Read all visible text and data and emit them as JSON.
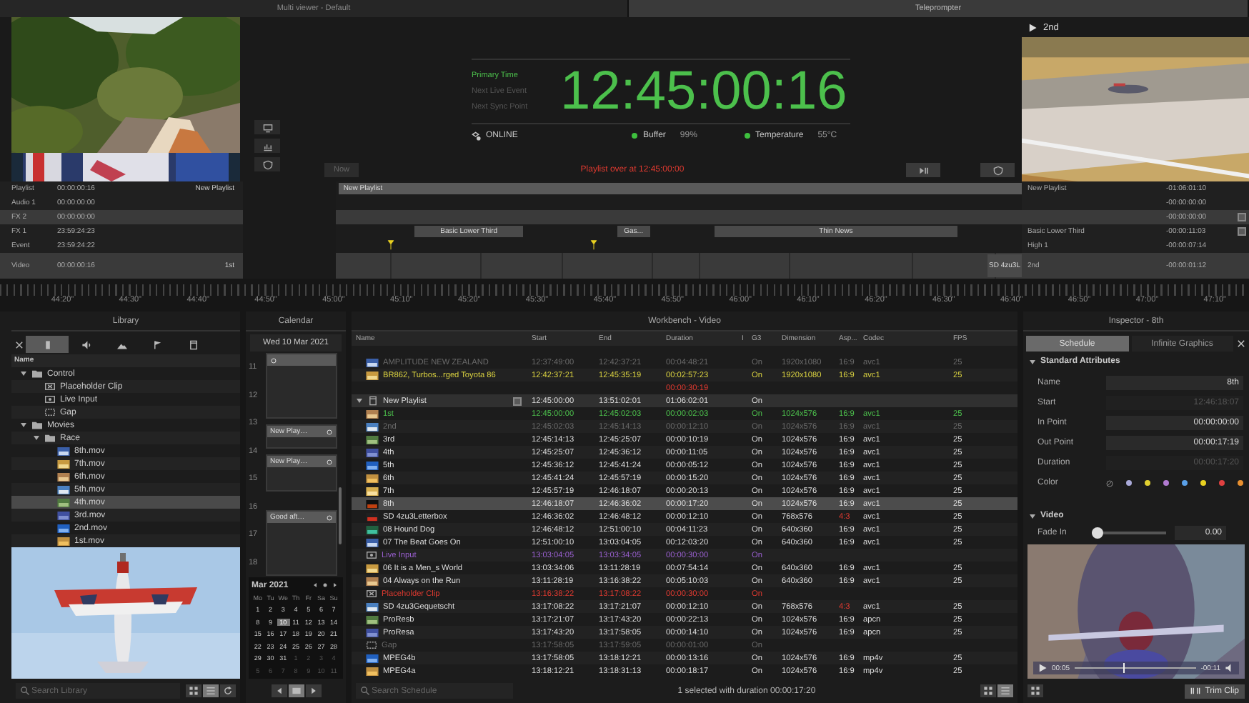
{
  "multiviewer": {
    "title": "Multi viewer - Default"
  },
  "teleprompter": {
    "title": "Teleprompter"
  },
  "clock": {
    "labels": [
      {
        "text": "Primary Time",
        "selected": true
      },
      {
        "text": "Next Live Event",
        "selected": false
      },
      {
        "text": "Next Sync Point",
        "selected": false
      }
    ],
    "time": "12:45:00:16",
    "connection": "ONLINE",
    "meters": [
      {
        "label": "Buffer",
        "value": "99%",
        "ok": true
      },
      {
        "label": "Temperature",
        "value": "55°C",
        "ok": true
      }
    ],
    "message": "Playlist over at 12:45:00:00",
    "now_button": {
      "label": "Now",
      "disabled": true
    }
  },
  "preview": {
    "title": "2nd"
  },
  "tracks": [
    {
      "name": "Playlist",
      "time": "00:00:00:16",
      "clip": "New Playlist",
      "shaded": false,
      "items": [
        {
          "kind": "bar",
          "label": "New Playlist"
        }
      ]
    },
    {
      "name": "Audio 1",
      "time": "00:00:00:00",
      "shaded": false
    },
    {
      "name": "FX 2",
      "time": "00:00:00:00",
      "shaded": true
    },
    {
      "name": "FX 1",
      "time": "23:59:24:23",
      "shaded": false,
      "items": [
        {
          "kind": "clip",
          "label": "Basic Lower Third"
        },
        {
          "kind": "clip",
          "label": "Gas..."
        },
        {
          "kind": "clip",
          "label": "Thin News"
        }
      ]
    },
    {
      "name": "Event",
      "time": "23:59:24:22",
      "shaded": false,
      "items": [
        {
          "kind": "marker"
        },
        {
          "kind": "marker"
        }
      ]
    },
    {
      "name": "Video",
      "time": "00:00:00:16",
      "clip": "1st",
      "shaded": true,
      "items": [
        {
          "kind": "clip",
          "label": "SD 4zu3L"
        }
      ]
    }
  ],
  "remaining": [
    {
      "name": "New Playlist",
      "time": "-01:06:01:10",
      "button": false
    },
    {
      "time": "-00:00:00:00",
      "button": false
    },
    {
      "time": "-00:00:00:00",
      "button": true
    },
    {
      "name": "Basic Lower Third",
      "time": "-00:00:11:03",
      "button": true
    },
    {
      "name": "High 1",
      "time": "-00:00:07:14",
      "button": false
    },
    {
      "name": "2nd",
      "time": "-00:00:01:12",
      "button": false
    }
  ],
  "ruler": [
    "44:20\"",
    "44:30\"",
    "44:40\"",
    "44:50\"",
    "45:00\"",
    "45:10\"",
    "45:20\"",
    "45:30\"",
    "45:40\"",
    "45:50\"",
    "46:00\"",
    "46:10\"",
    "46:20\"",
    "46:30\"",
    "46:40\"",
    "46:50\"",
    "47:00\"",
    "47:10\""
  ],
  "library": {
    "title": "Library",
    "tabs": [
      {
        "kind": "close",
        "selected": false
      },
      {
        "kind": "clips",
        "selected": true
      },
      {
        "kind": "audio",
        "selected": false
      },
      {
        "kind": "graphics",
        "selected": false
      },
      {
        "kind": "events",
        "selected": false
      },
      {
        "kind": "document",
        "selected": false
      }
    ],
    "column": "Name",
    "tree": [
      {
        "label": "Control",
        "kind": "folder",
        "expanded": true,
        "selected": false,
        "children": [
          {
            "label": "Placeholder Clip",
            "kind": "placeholder",
            "selected": false
          },
          {
            "label": "Live Input",
            "kind": "live",
            "selected": false
          },
          {
            "label": "Gap",
            "kind": "gap",
            "selected": false
          }
        ]
      },
      {
        "label": "Movies",
        "kind": "folder",
        "expanded": true,
        "selected": false,
        "children": [
          {
            "label": "Race",
            "kind": "folder",
            "expanded": true,
            "selected": false,
            "children": [
              {
                "label": "8th.mov",
                "kind": "movie",
                "selected": false
              },
              {
                "label": "7th.mov",
                "kind": "movie",
                "selected": false
              },
              {
                "label": "6th.mov",
                "kind": "movie",
                "selected": false
              },
              {
                "label": "5th.mov",
                "kind": "movie",
                "selected": false
              },
              {
                "label": "4th.mov",
                "kind": "movie",
                "selected": true
              },
              {
                "label": "3rd.mov",
                "kind": "movie",
                "selected": false
              },
              {
                "label": "2nd.mov",
                "kind": "movie",
                "selected": false
              },
              {
                "label": "1st.mov",
                "kind": "movie",
                "selected": false
              }
            ]
          }
        ]
      }
    ],
    "search": {
      "placeholder": "Search Library"
    },
    "views": [
      {
        "kind": "grid",
        "selected": false
      },
      {
        "kind": "list",
        "selected": true
      },
      {
        "kind": "refresh",
        "selected": false
      }
    ]
  },
  "calendar": {
    "title": "Calendar",
    "date": "Wed 10 Mar 2021",
    "hours": [
      "11",
      "12",
      "13",
      "14",
      "15",
      "16",
      "17",
      "18"
    ],
    "events": [
      {
        "kind": "event"
      },
      {
        "kind": "event",
        "label": "New Play…"
      },
      {
        "kind": "event",
        "label": "New Play…"
      },
      {
        "kind": "event",
        "label": "Good aft…"
      }
    ],
    "month": "Mar 2021",
    "weekdays": [
      "Mo",
      "Tu",
      "We",
      "Th",
      "Fr",
      "Sa",
      "Su"
    ],
    "days": [
      {
        "text": "1",
        "selected": false,
        "outside": false
      },
      {
        "text": "2",
        "selected": false,
        "outside": false
      },
      {
        "text": "3",
        "selected": false,
        "outside": false
      },
      {
        "text": "4",
        "selected": false,
        "outside": false
      },
      {
        "text": "5",
        "selected": false,
        "outside": false
      },
      {
        "text": "6",
        "selected": false,
        "outside": false
      },
      {
        "text": "7",
        "selected": false,
        "outside": false
      },
      {
        "text": "8",
        "selected": false,
        "outside": false
      },
      {
        "text": "9",
        "selected": false,
        "outside": false
      },
      {
        "text": "10",
        "selected": true,
        "outside": false
      },
      {
        "text": "11",
        "selected": false,
        "outside": false
      },
      {
        "text": "12",
        "selected": false,
        "outside": false
      },
      {
        "text": "13",
        "selected": false,
        "outside": false
      },
      {
        "text": "14",
        "selected": false,
        "outside": false
      },
      {
        "text": "15",
        "selected": false,
        "outside": false
      },
      {
        "text": "16",
        "selected": false,
        "outside": false
      },
      {
        "text": "17",
        "selected": false,
        "outside": false
      },
      {
        "text": "18",
        "selected": false,
        "outside": false
      },
      {
        "text": "19",
        "selected": false,
        "outside": false
      },
      {
        "text": "20",
        "selected": false,
        "outside": false
      },
      {
        "text": "21",
        "selected": false,
        "outside": false
      },
      {
        "text": "22",
        "selected": false,
        "outside": false
      },
      {
        "text": "23",
        "selected": false,
        "outside": false
      },
      {
        "text": "24",
        "selected": false,
        "outside": false
      },
      {
        "text": "25",
        "selected": false,
        "outside": false
      },
      {
        "text": "26",
        "selected": false,
        "outside": false
      },
      {
        "text": "27",
        "selected": false,
        "outside": false
      },
      {
        "text": "28",
        "selected": false,
        "outside": false
      },
      {
        "text": "29",
        "selected": false,
        "outside": false
      },
      {
        "text": "30",
        "selected": false,
        "outside": false
      },
      {
        "text": "31",
        "selected": false,
        "outside": false
      },
      {
        "text": "1",
        "selected": false,
        "outside": true
      },
      {
        "text": "2",
        "selected": false,
        "outside": true
      },
      {
        "text": "3",
        "selected": false,
        "outside": true
      },
      {
        "text": "4",
        "selected": false,
        "outside": true
      },
      {
        "text": "5",
        "selected": false,
        "outside": true
      },
      {
        "text": "6",
        "selected": false,
        "outside": true
      },
      {
        "text": "7",
        "selected": false,
        "outside": true
      },
      {
        "text": "8",
        "selected": false,
        "outside": true
      },
      {
        "text": "9",
        "selected": false,
        "outside": true
      },
      {
        "text": "10",
        "selected": false,
        "outside": true
      },
      {
        "text": "11",
        "selected": false,
        "outside": true
      }
    ]
  },
  "workbench": {
    "title": "Workbench - Video",
    "columns": [
      "Name",
      "Start",
      "End",
      "Duration",
      "I",
      "G3",
      "Dimension",
      "Asp...",
      "Codec",
      "FPS"
    ],
    "rows": [
      {
        "kind": "clip",
        "color": "#6a6a6a",
        "selected": false,
        "name": "AMPLITUDE NEW ZEALAND",
        "start": "12:37:49:00",
        "end": "12:42:37:21",
        "duration": "00:04:48:21",
        "io": "On",
        "dimension": "1920x1080",
        "aspect": "16:9",
        "aspect_alert": false,
        "codec": "avc1",
        "fps": "25"
      },
      {
        "kind": "clip",
        "color": "#d8d040",
        "selected": false,
        "name": "BR862, Turbos...rged Toyota 86",
        "start": "12:42:37:21",
        "end": "12:45:35:19",
        "duration": "00:02:57:23",
        "io": "On",
        "dimension": "1920x1080",
        "aspect": "16:9",
        "aspect_alert": false,
        "codec": "avc1",
        "fps": "25"
      },
      {
        "kind": "spacer",
        "color": "#e03a30",
        "selected": false,
        "duration": "00:00:30:19"
      },
      {
        "kind": "group",
        "color": "#dddddd",
        "selected": false,
        "name": "New Playlist",
        "start": "12:45:00:00",
        "end": "13:51:02:01",
        "duration": "01:06:02:01",
        "io": "On"
      },
      {
        "kind": "clip",
        "color": "#4cc04c",
        "selected": false,
        "name": "1st",
        "start": "12:45:00:00",
        "end": "12:45:02:03",
        "duration": "00:00:02:03",
        "io": "On",
        "dimension": "1024x576",
        "aspect": "16:9",
        "aspect_alert": false,
        "codec": "avc1",
        "fps": "25"
      },
      {
        "kind": "clip",
        "color": "#6a6a6a",
        "selected": false,
        "name": "2nd",
        "start": "12:45:02:03",
        "end": "12:45:14:13",
        "duration": "00:00:12:10",
        "io": "On",
        "dimension": "1024x576",
        "aspect": "16:9",
        "aspect_alert": false,
        "codec": "avc1",
        "fps": "25"
      },
      {
        "kind": "clip",
        "color": "#dddddd",
        "selected": false,
        "name": "3rd",
        "start": "12:45:14:13",
        "end": "12:45:25:07",
        "duration": "00:00:10:19",
        "io": "On",
        "dimension": "1024x576",
        "aspect": "16:9",
        "aspect_alert": false,
        "codec": "avc1",
        "fps": "25"
      },
      {
        "kind": "clip",
        "color": "#dddddd",
        "selected": false,
        "name": "4th",
        "start": "12:45:25:07",
        "end": "12:45:36:12",
        "duration": "00:00:11:05",
        "io": "On",
        "dimension": "1024x576",
        "aspect": "16:9",
        "aspect_alert": false,
        "codec": "avc1",
        "fps": "25"
      },
      {
        "kind": "clip",
        "color": "#dddddd",
        "selected": false,
        "name": "5th",
        "start": "12:45:36:12",
        "end": "12:45:41:24",
        "duration": "00:00:05:12",
        "io": "On",
        "dimension": "1024x576",
        "aspect": "16:9",
        "aspect_alert": false,
        "codec": "avc1",
        "fps": "25"
      },
      {
        "kind": "clip",
        "color": "#dddddd",
        "selected": false,
        "name": "6th",
        "start": "12:45:41:24",
        "end": "12:45:57:19",
        "duration": "00:00:15:20",
        "io": "On",
        "dimension": "1024x576",
        "aspect": "16:9",
        "aspect_alert": false,
        "codec": "avc1",
        "fps": "25"
      },
      {
        "kind": "clip",
        "color": "#dddddd",
        "selected": false,
        "name": "7th",
        "start": "12:45:57:19",
        "end": "12:46:18:07",
        "duration": "00:00:20:13",
        "io": "On",
        "dimension": "1024x576",
        "aspect": "16:9",
        "aspect_alert": false,
        "codec": "avc1",
        "fps": "25"
      },
      {
        "kind": "clip",
        "color": "#dddddd",
        "selected": true,
        "name": "8th",
        "start": "12:46:18:07",
        "end": "12:46:36:02",
        "duration": "00:00:17:20",
        "io": "On",
        "dimension": "1024x576",
        "aspect": "16:9",
        "aspect_alert": false,
        "codec": "avc1",
        "fps": "25"
      },
      {
        "kind": "clip",
        "color": "#dddddd",
        "selected": false,
        "name": "SD 4zu3Letterbox",
        "start": "12:46:36:02",
        "end": "12:46:48:12",
        "duration": "00:00:12:10",
        "io": "On",
        "dimension": "768x576",
        "aspect": "4:3",
        "aspect_alert": true,
        "codec": "avc1",
        "fps": "25"
      },
      {
        "kind": "clip",
        "color": "#dddddd",
        "selected": false,
        "name": "08 Hound Dog",
        "start": "12:46:48:12",
        "end": "12:51:00:10",
        "duration": "00:04:11:23",
        "io": "On",
        "dimension": "640x360",
        "aspect": "16:9",
        "aspect_alert": false,
        "codec": "avc1",
        "fps": "25"
      },
      {
        "kind": "clip",
        "color": "#dddddd",
        "selected": false,
        "name": "07 The Beat Goes On",
        "start": "12:51:00:10",
        "end": "13:03:04:05",
        "duration": "00:12:03:20",
        "io": "On",
        "dimension": "640x360",
        "aspect": "16:9",
        "aspect_alert": false,
        "codec": "avc1",
        "fps": "25"
      },
      {
        "kind": "live",
        "color": "#9a60d0",
        "selected": false,
        "name": "Live Input",
        "start": "13:03:04:05",
        "end": "13:03:34:05",
        "duration": "00:00:30:00",
        "io": "On"
      },
      {
        "kind": "clip",
        "color": "#dddddd",
        "selected": false,
        "name": "06 It is a Men_s World",
        "start": "13:03:34:06",
        "end": "13:11:28:19",
        "duration": "00:07:54:14",
        "io": "On",
        "dimension": "640x360",
        "aspect": "16:9",
        "aspect_alert": false,
        "codec": "avc1",
        "fps": "25"
      },
      {
        "kind": "clip",
        "color": "#dddddd",
        "selected": false,
        "name": "04 Always on the Run",
        "start": "13:11:28:19",
        "end": "13:16:38:22",
        "duration": "00:05:10:03",
        "io": "On",
        "dimension": "640x360",
        "aspect": "16:9",
        "aspect_alert": false,
        "codec": "avc1",
        "fps": "25"
      },
      {
        "kind": "placeholder",
        "color": "#e03a30",
        "selected": false,
        "name": "Placeholder Clip",
        "start": "13:16:38:22",
        "end": "13:17:08:22",
        "duration": "00:00:30:00",
        "io": "On"
      },
      {
        "kind": "clip",
        "color": "#dddddd",
        "selected": false,
        "name": "SD 4zu3Gequetscht",
        "start": "13:17:08:22",
        "end": "13:17:21:07",
        "duration": "00:00:12:10",
        "io": "On",
        "dimension": "768x576",
        "aspect": "4:3",
        "aspect_alert": true,
        "codec": "avc1",
        "fps": "25"
      },
      {
        "kind": "clip",
        "color": "#dddddd",
        "selected": false,
        "name": "ProResb",
        "start": "13:17:21:07",
        "end": "13:17:43:20",
        "duration": "00:00:22:13",
        "io": "On",
        "dimension": "1024x576",
        "aspect": "16:9",
        "aspect_alert": false,
        "codec": "apcn",
        "fps": "25"
      },
      {
        "kind": "clip",
        "color": "#dddddd",
        "selected": false,
        "name": "ProResa",
        "start": "13:17:43:20",
        "end": "13:17:58:05",
        "duration": "00:00:14:10",
        "io": "On",
        "dimension": "1024x576",
        "aspect": "16:9",
        "aspect_alert": false,
        "codec": "apcn",
        "fps": "25"
      },
      {
        "kind": "gap",
        "color": "#6a6a6a",
        "selected": false,
        "name": "Gap",
        "start": "13:17:58:05",
        "end": "13:17:59:05",
        "duration": "00:00:01:00",
        "io": "On"
      },
      {
        "kind": "clip",
        "color": "#dddddd",
        "selected": false,
        "name": "MPEG4b",
        "start": "13:17:58:05",
        "end": "13:18:12:21",
        "duration": "00:00:13:16",
        "io": "On",
        "dimension": "1024x576",
        "aspect": "16:9",
        "aspect_alert": false,
        "codec": "mp4v",
        "fps": "25"
      },
      {
        "kind": "clip",
        "color": "#dddddd",
        "selected": false,
        "name": "MPEG4a",
        "start": "13:18:12:21",
        "end": "13:18:31:13",
        "duration": "00:00:18:17",
        "io": "On",
        "dimension": "1024x576",
        "aspect": "16:9",
        "aspect_alert": false,
        "codec": "mp4v",
        "fps": "25"
      }
    ],
    "search": {
      "placeholder": "Search Schedule"
    },
    "summary": "1 selected with duration 00:00:17:20",
    "views": [
      {
        "selected": false
      },
      {
        "selected": true
      }
    ]
  },
  "inspector": {
    "title": "Inspector - 8th",
    "tabs": [
      {
        "label": "Schedule",
        "selected": true
      },
      {
        "label": "Infinite Graphics",
        "selected": false
      }
    ],
    "section": {
      "title": "Standard Attributes",
      "expanded": true
    },
    "fields": [
      {
        "label": "Name",
        "value": "8th",
        "disabled": false
      },
      {
        "label": "Start",
        "value": "12:46:18:07",
        "disabled": true
      },
      {
        "label": "In Point",
        "value": "00:00:00:00",
        "disabled": false
      },
      {
        "label": "Out Point",
        "value": "00:00:17:19",
        "disabled": false
      },
      {
        "label": "Duration",
        "value": "00:00:17:20",
        "disabled": true
      }
    ],
    "color_label": "Color",
    "colors": [
      {
        "kind": "none"
      },
      {
        "kind": "swatch",
        "color": "#a9a9d8"
      },
      {
        "kind": "swatch",
        "color": "#e0d030"
      },
      {
        "kind": "swatch",
        "color": "#b07ad0"
      },
      {
        "kind": "swatch",
        "color": "#5aa0e8"
      },
      {
        "kind": "swatch",
        "color": "#e8d020"
      },
      {
        "kind": "swatch",
        "color": "#e04040"
      },
      {
        "kind": "swatch",
        "color": "#e89030"
      }
    ],
    "video": {
      "title": "Video",
      "expanded": true,
      "fade": {
        "label": "Fade In",
        "level": 0,
        "value": "0.00"
      }
    },
    "player": {
      "elapsed": "00:05",
      "remaining": "-00:11",
      "level": 0.4
    },
    "trim_button": "Trim Clip"
  }
}
